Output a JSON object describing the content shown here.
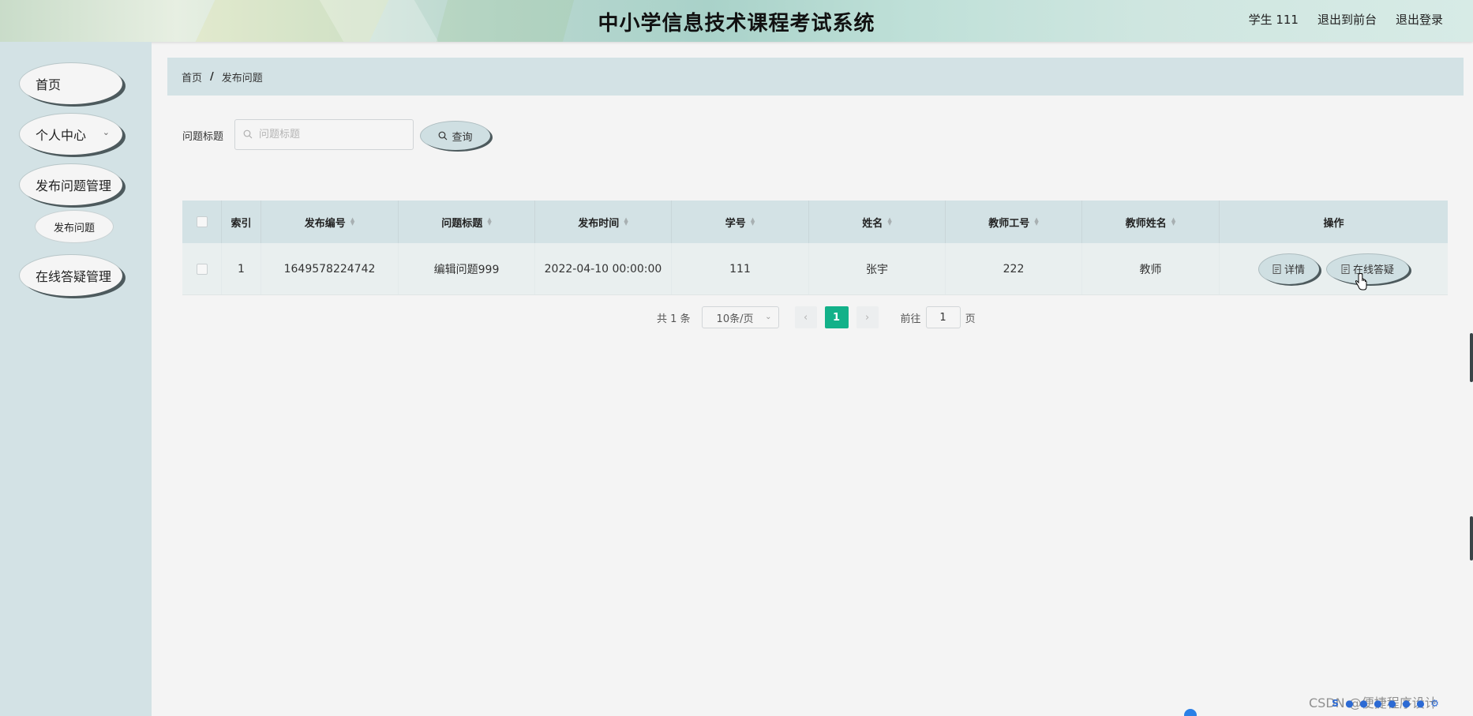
{
  "header": {
    "title": "中小学信息技术课程考试系统",
    "user_label": "学生 111",
    "back_to_front": "退出到前台",
    "logout": "退出登录"
  },
  "sidebar": {
    "items": [
      {
        "label": "首页"
      },
      {
        "label": "个人中心"
      },
      {
        "label": "发布问题管理"
      },
      {
        "label": "发布问题"
      },
      {
        "label": "在线答疑管理"
      }
    ]
  },
  "breadcrumb": {
    "home": "首页",
    "separator": "/",
    "current": "发布问题"
  },
  "search": {
    "label": "问题标题",
    "placeholder": "问题标题",
    "button": "查询"
  },
  "table": {
    "columns": [
      "索引",
      "发布编号",
      "问题标题",
      "发布时间",
      "学号",
      "姓名",
      "教师工号",
      "教师姓名",
      "操作"
    ],
    "rows": [
      {
        "index": "1",
        "publish_no": "1649578224742",
        "question_title": "编辑问题999",
        "publish_time": "2022-04-10 00:00:00",
        "student_no": "111",
        "name": "张宇",
        "teacher_no": "222",
        "teacher_name": "教师",
        "detail_btn": "详情",
        "answer_btn": "在线答疑"
      }
    ]
  },
  "pagination": {
    "total": "共 1 条",
    "page_size": "10条/页",
    "current_page": "1",
    "goto_label": "前往",
    "goto_value": "1",
    "page_suffix": "页"
  },
  "watermark": "CSDN @便捷程序设计",
  "colors": {
    "accent": "#13b189",
    "sidebar_bg": "#d3e2e5",
    "button_bg": "#cfdfe2"
  }
}
